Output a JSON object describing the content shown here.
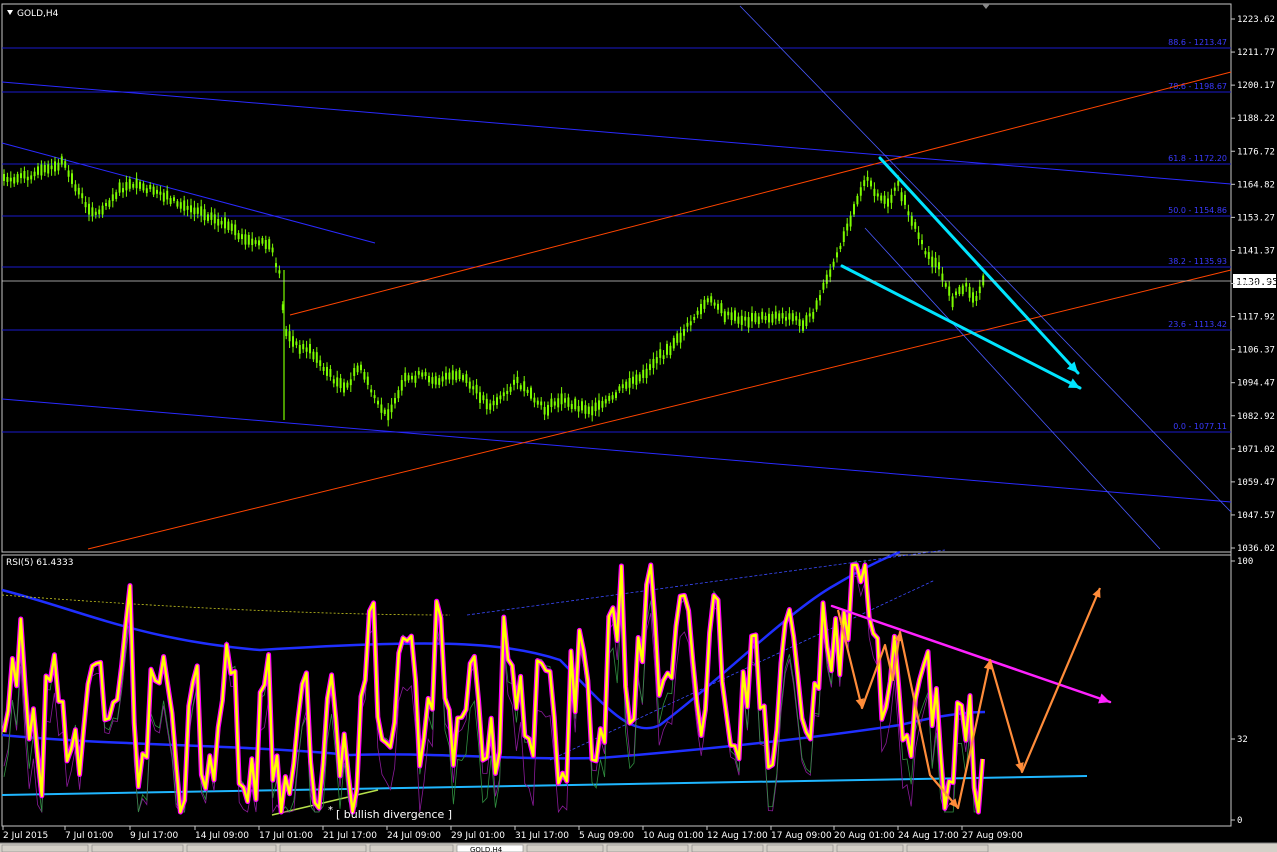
{
  "price_chart": {
    "symbol_label": "GOLD,H4",
    "current_price": "1130.95",
    "y_axis_ticks": [
      "1223.62",
      "1211.77",
      "1200.17",
      "1188.22",
      "1176.72",
      "1164.82",
      "1153.27",
      "1141.37",
      "1129.77",
      "1117.92",
      "1106.37",
      "1094.47",
      "1082.92",
      "1071.02",
      "1059.47",
      "1047.57",
      "1036.02"
    ],
    "fib_levels": [
      "88.6 - 1213.47",
      "78.6 - 1198.67",
      "61.8 - 1172.20",
      "50.0 - 1154.86",
      "38.2 - 1135.93",
      "23.6 - 1113.42",
      "0.0 - 1077.11"
    ]
  },
  "rsi_panel": {
    "label": "RSI(5) 61.4333",
    "y_axis_ticks": [
      "100",
      "32",
      "0"
    ],
    "annotation": "[ bullish divergence ]"
  },
  "time_axis": {
    "labels": [
      "2 Jul 2015",
      "7 Jul 01:00",
      "9 Jul 17:00",
      "14 Jul 09:00",
      "17 Jul 01:00",
      "21 Jul 17:00",
      "24 Jul 09:00",
      "29 Jul 01:00",
      "31 Jul 17:00",
      "5 Aug 09:00",
      "10 Aug 01:00",
      "12 Aug 17:00",
      "17 Aug 09:00",
      "20 Aug 01:00",
      "24 Aug 17:00",
      "27 Aug 09:00"
    ]
  },
  "tabs": {
    "active_label": "GOLD,H4"
  },
  "colors": {
    "candle_up": "#7CFC00",
    "fib_line": "#1a1acd",
    "channel_orange": "#ff4500",
    "cyan_arrow": "#00e5ff",
    "rsi_main": "#ffff00",
    "rsi_shadow": "#ff00ff",
    "trend_magenta": "#ff22ff",
    "projection_orange": "#ff8c3a"
  }
}
